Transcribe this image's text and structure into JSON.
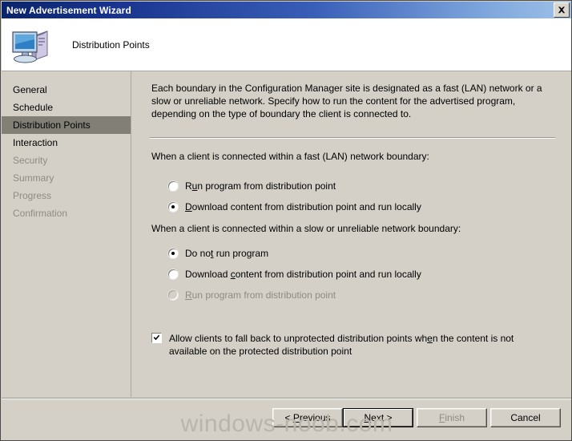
{
  "window": {
    "title": "New Advertisement Wizard",
    "close_icon": "close-icon"
  },
  "header": {
    "title": "Distribution Points",
    "icon": "computer-icon"
  },
  "sidebar": {
    "items": [
      {
        "label": "General",
        "state": "done"
      },
      {
        "label": "Schedule",
        "state": "done"
      },
      {
        "label": "Distribution Points",
        "state": "current"
      },
      {
        "label": "Interaction",
        "state": "done"
      },
      {
        "label": "Security",
        "state": "pending"
      },
      {
        "label": "Summary",
        "state": "pending"
      },
      {
        "label": "Progress",
        "state": "pending"
      },
      {
        "label": "Confirmation",
        "state": "pending"
      }
    ]
  },
  "content": {
    "description": "Each boundary in the Configuration Manager site is designated as a fast (LAN) network or a slow or unreliable network. Specify how to run the content for the advertised program, depending on the type of boundary the client is connected to.",
    "fast_group": {
      "label": "When a client is connected within a fast (LAN) network boundary:",
      "options": [
        {
          "label_pre": "R",
          "label_accel": "u",
          "label_post": "n program from distribution point",
          "selected": false,
          "disabled": false
        },
        {
          "label_pre": "",
          "label_accel": "D",
          "label_post": "ownload content from distribution point and run locally",
          "selected": true,
          "disabled": false
        }
      ]
    },
    "slow_group": {
      "label": "When a client is connected within a slow or unreliable network boundary:",
      "options": [
        {
          "label_pre": "Do no",
          "label_accel": "t",
          "label_post": " run program",
          "selected": true,
          "disabled": false
        },
        {
          "label_pre": "Download ",
          "label_accel": "c",
          "label_post": "ontent from distribution point and run locally",
          "selected": false,
          "disabled": false
        },
        {
          "label_pre": "",
          "label_accel": "R",
          "label_post": "un program from distribution point",
          "selected": false,
          "disabled": true
        }
      ]
    },
    "fallback_checkbox": {
      "label_pre": "Allow clients to fall back to unprotected distribution points wh",
      "label_accel": "e",
      "label_post": "n the content is not available on the protected distribution point",
      "checked": true
    }
  },
  "footer": {
    "previous": {
      "pre": "< ",
      "accel": "P",
      "post": "revious",
      "disabled": false
    },
    "next": {
      "pre": "",
      "accel": "N",
      "post": "ext >",
      "disabled": false,
      "is_default": true
    },
    "finish": {
      "pre": "",
      "accel": "F",
      "post": "inish",
      "disabled": true
    },
    "cancel": {
      "pre": "Cancel",
      "accel": "",
      "post": "",
      "disabled": false
    }
  },
  "watermark": {
    "text": "windows-noob.com"
  }
}
